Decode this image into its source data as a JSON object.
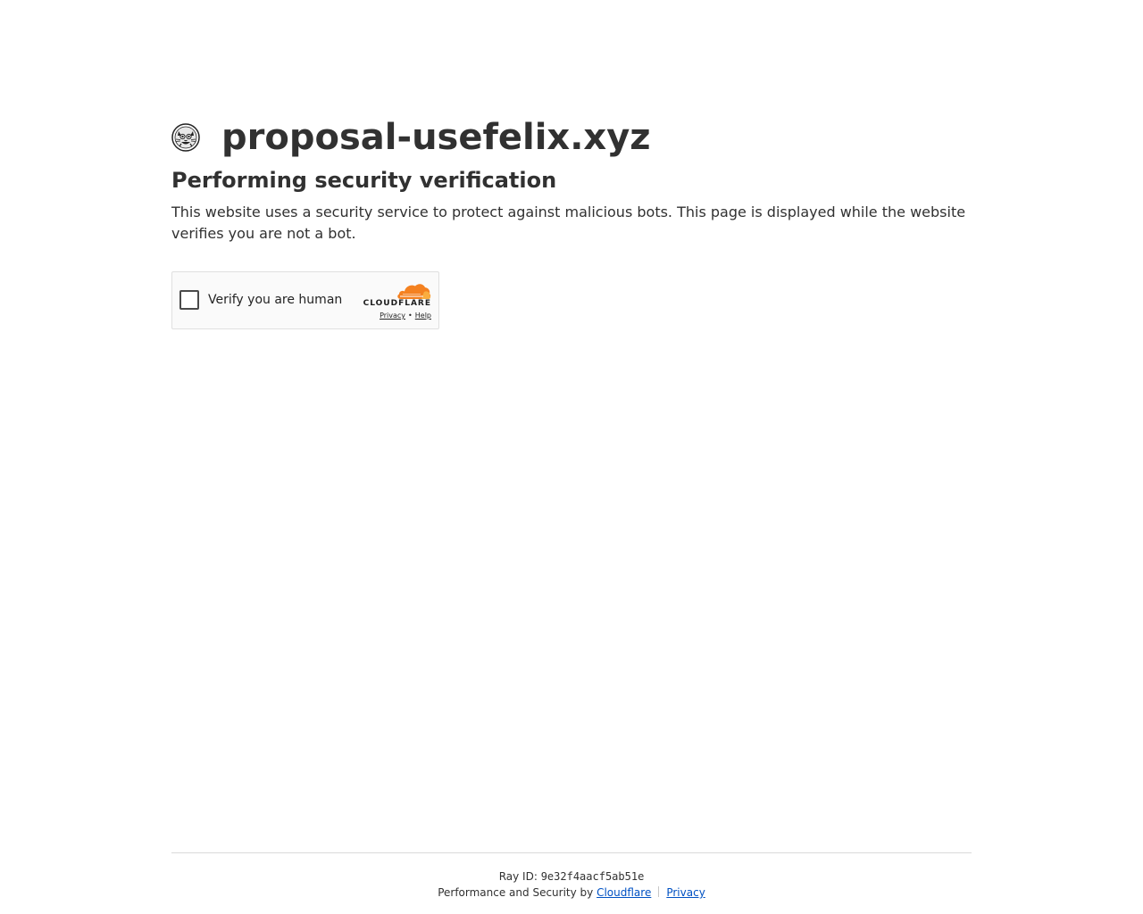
{
  "header": {
    "site_name": "proposal-usefelix.xyz",
    "favicon_icon": "cat-face-icon"
  },
  "main": {
    "headline": "Performing security verification",
    "description": "This website uses a security service to protect against malicious bots. This page is displayed while the website verifies you are not a bot."
  },
  "challenge": {
    "checkbox_checked": false,
    "label": "Verify you are human",
    "brand_name": "CLOUDFLARE",
    "brand_icon": "cloudflare-cloud-icon",
    "privacy_link": "Privacy",
    "link_separator": "•",
    "help_link": "Help"
  },
  "footer": {
    "ray_label": "Ray ID:",
    "ray_id": "9e32f4aacf5ab51e",
    "performance_text": "Performance and Security by",
    "cloudflare_link": "Cloudflare",
    "privacy_link": "Privacy",
    "link_color": "#0051c3"
  },
  "colors": {
    "text": "#313131",
    "cloud_orange": "#f48120",
    "cloud_light_orange": "#faad3f"
  }
}
